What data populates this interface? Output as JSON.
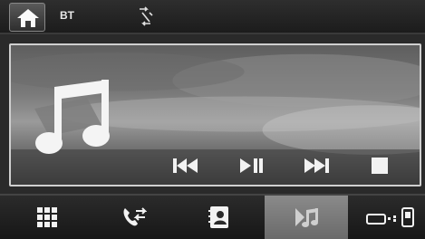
{
  "statusbar": {
    "title": "BT",
    "icons": [
      "home-icon",
      "sync-arrows-icon"
    ]
  },
  "main": {
    "art_icon": "music-note-icon",
    "controls": [
      "previous-track-icon",
      "play-pause-icon",
      "next-track-icon",
      "stop-icon"
    ]
  },
  "dock": {
    "items": [
      "apps-grid-icon",
      "call-transfer-icon",
      "contacts-icon",
      "music-icon",
      "phone-device-icon"
    ],
    "active": "music-icon"
  },
  "colors": {
    "icon": "#f2f2f2",
    "frame": "#cfcfcf",
    "active_tab": "#7a7a7a"
  }
}
